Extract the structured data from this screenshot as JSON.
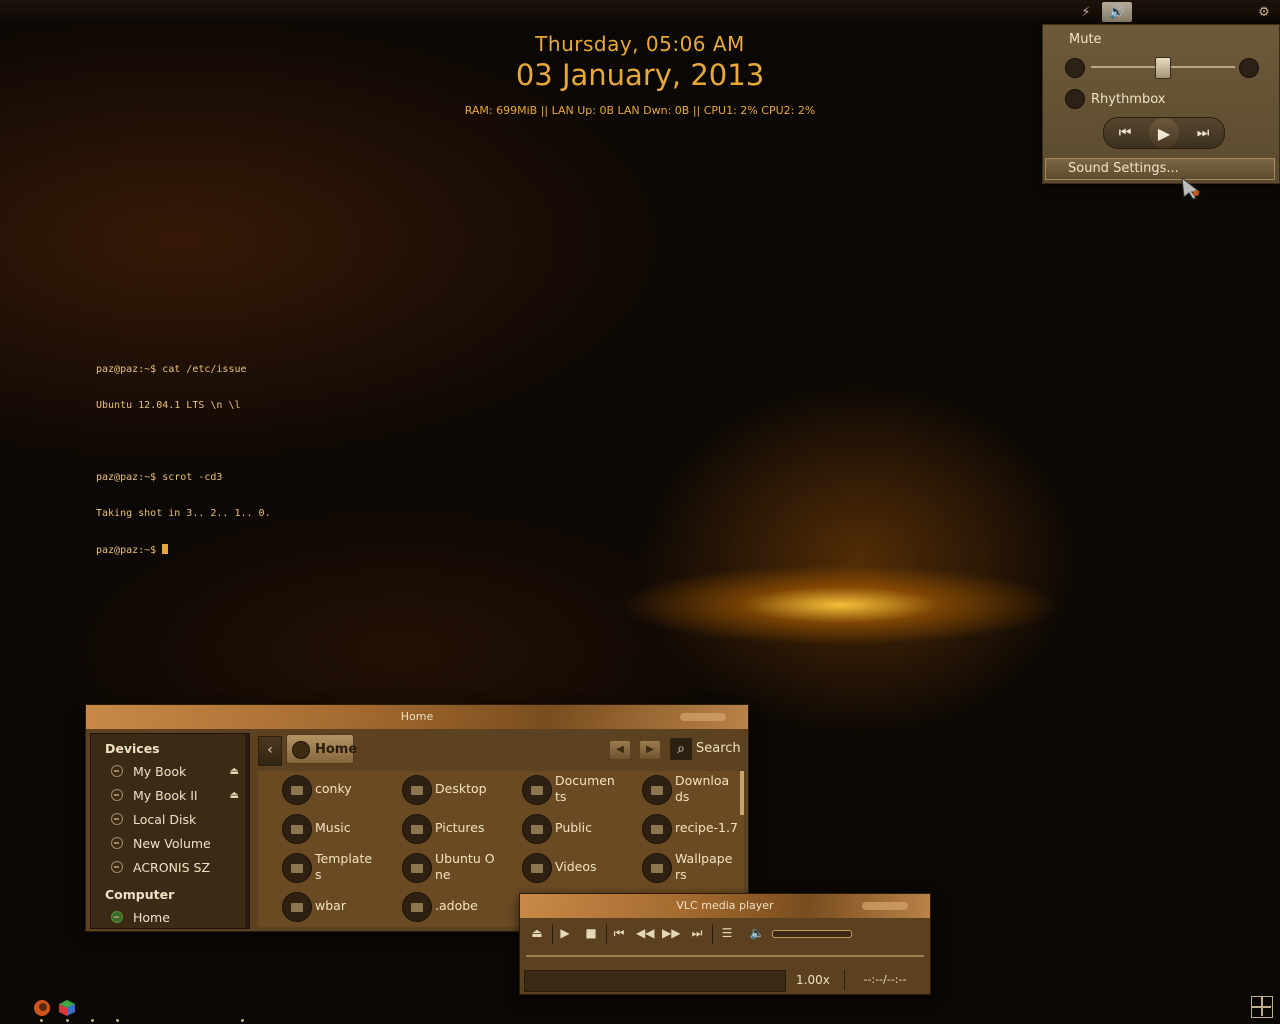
{
  "conky": {
    "day_time": "Thursday, 05:06 AM",
    "date": "03 January, 2013",
    "stats": "RAM: 699MiB || LAN Up: 0B LAN Dwn: 0B || CPU1: 2% CPU2: 2%"
  },
  "terminal": {
    "lines": [
      "paz@paz:~$ cat /etc/issue",
      "Ubuntu 12.04.1 LTS \\n \\l",
      "",
      "paz@paz:~$ scrot -cd3",
      "Taking shot in 3.. 2.. 1.. 0.",
      "paz@paz:~$ "
    ]
  },
  "sound_menu": {
    "mute_label": "Mute",
    "volume_level": 0.5,
    "player_name": "Rhythmbox",
    "settings_label": "Sound Settings..."
  },
  "file_manager": {
    "title": "Home",
    "sidebar": {
      "devices_header": "Devices",
      "devices": [
        "My Book",
        "My Book II",
        "Local Disk",
        "New Volume",
        "ACRONIS SZ"
      ],
      "ejectable": [
        true,
        true,
        false,
        false,
        false
      ],
      "computer_header": "Computer",
      "computer_items": [
        "Home"
      ]
    },
    "breadcrumb_home": "Home",
    "search_label": "Search",
    "files": [
      "conky",
      "Desktop",
      "Documents",
      "Downloads",
      "Music",
      "Pictures",
      "Public",
      "recipe-1.7",
      "Templates",
      "Ubuntu One",
      "Videos",
      "Wallpapers",
      "wbar",
      ".adobe"
    ],
    "file_display": [
      "conky",
      "Desktop",
      "Documen ts",
      "Downloa ds",
      "Music",
      "Pictures",
      "Public",
      "recipe-1.7",
      "Template s",
      "Ubuntu One",
      "Videos",
      "Wallpape rs",
      "wbar",
      ".adobe"
    ]
  },
  "vlc": {
    "title": "VLC media player",
    "speed": "1.00x",
    "time": "--:--/--:--"
  },
  "colors": {
    "accent": "#e8a93a",
    "panel": "#6a4a22",
    "desktop": "#0b0704"
  }
}
